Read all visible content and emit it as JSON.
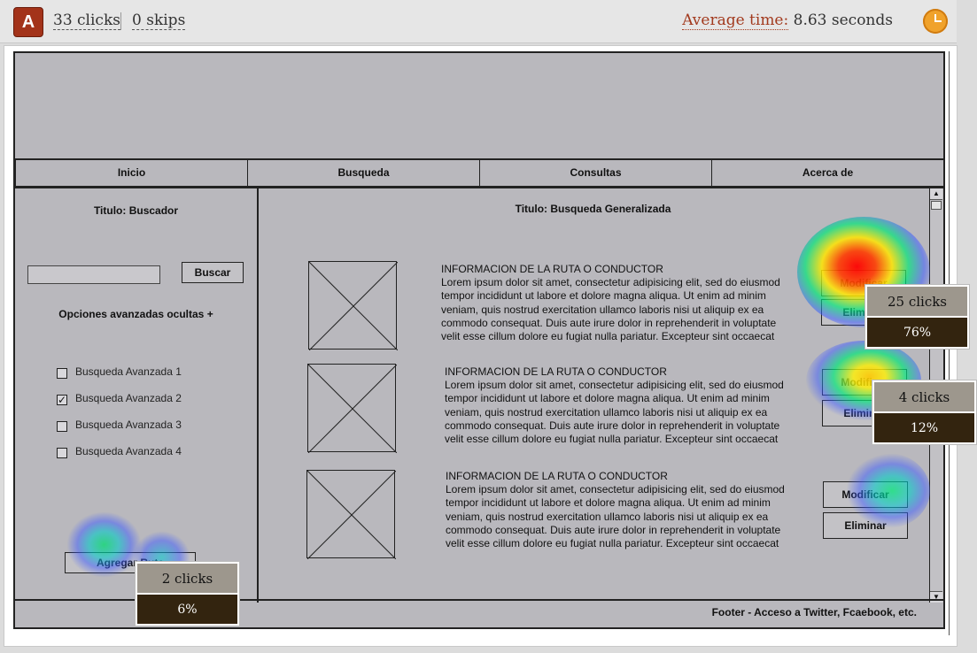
{
  "header": {
    "logo_letter": "A",
    "clicks": "33 clicks",
    "skips": "0 skips",
    "average_label": "Average time:",
    "average_value": "8.63 seconds"
  },
  "mockup": {
    "nav": [
      "Inicio",
      "Busqueda",
      "Consultas",
      "Acerca de"
    ],
    "sidebar": {
      "title": "Titulo: Buscador",
      "search_button": "Buscar",
      "advanced_toggle": "Opciones avanzadas ocultas +",
      "options": [
        {
          "label": "Busqueda Avanzada 1",
          "checked": false,
          "mark": ""
        },
        {
          "label": "Busqueda Avanzada 2",
          "checked": true,
          "mark": "✓"
        },
        {
          "label": "Busqueda Avanzada 3",
          "checked": false,
          "mark": ""
        },
        {
          "label": "Busqueda Avanzada 4",
          "checked": false,
          "mark": ""
        }
      ],
      "add_route_button": "Agregar Ruta"
    },
    "main": {
      "title": "Titulo: Busqueda Generalizada",
      "items": [
        {
          "title": "INFORMACION DE LA RUTA O CONDUCTOR",
          "body": "Lorem ipsum dolor sit amet, consectetur adipisicing elit, sed do eiusmod tempor incididunt ut labore et dolore magna aliqua. Ut enim ad minim veniam, quis nostrud exercitation ullamco laboris nisi ut aliquip ex ea commodo consequat. Duis aute irure dolor in reprehenderit in voluptate velit esse cillum dolore eu fugiat nulla pariatur. Excepteur sint occaecat",
          "modify": "Modificar",
          "delete": "Eliminar"
        },
        {
          "title": "INFORMACION DE LA RUTA O CONDUCTOR",
          "body": "Lorem ipsum dolor sit amet, consectetur adipisicing elit, sed do eiusmod tempor incididunt ut labore et dolore magna aliqua. Ut enim ad minim veniam, quis nostrud exercitation ullamco laboris nisi ut aliquip ex ea commodo consequat. Duis aute irure dolor in reprehenderit in voluptate velit esse cillum dolore eu fugiat nulla pariatur. Excepteur sint occaecat",
          "modify": "Modificar",
          "delete": "Eliminar"
        },
        {
          "title": "INFORMACION DE LA RUTA O CONDUCTOR",
          "body": "Lorem ipsum dolor sit amet, consectetur adipisicing elit, sed do eiusmod tempor incididunt ut labore et dolore magna aliqua. Ut enim ad minim veniam, quis nostrud exercitation ullamco laboris nisi ut aliquip ex ea commodo consequat. Duis aute irure dolor in reprehenderit in voluptate velit esse cillum dolore eu fugiat nulla pariatur. Excepteur sint occaecat",
          "modify": "Modificar",
          "delete": "Eliminar"
        }
      ]
    },
    "footer": "Footer - Acceso a Twitter, Fcaebook, etc."
  },
  "heatmap_tooltips": [
    {
      "clicks": "25 clicks",
      "percent": "76%"
    },
    {
      "clicks": "4 clicks",
      "percent": "12%"
    },
    {
      "clicks": "2 clicks",
      "percent": "6%"
    }
  ],
  "colors": {
    "logo": "#a3331a",
    "accent_label": "#a23a1e",
    "mockup_bg": "#b9b8bd",
    "tooltip_dark": "#33240f",
    "tooltip_light": "#9d978d",
    "clock": "#f0a22b"
  },
  "icons": [
    "clock-icon",
    "placeholder-image-icon",
    "checkbox-icon",
    "scroll-up-icon",
    "scroll-down-icon"
  ]
}
